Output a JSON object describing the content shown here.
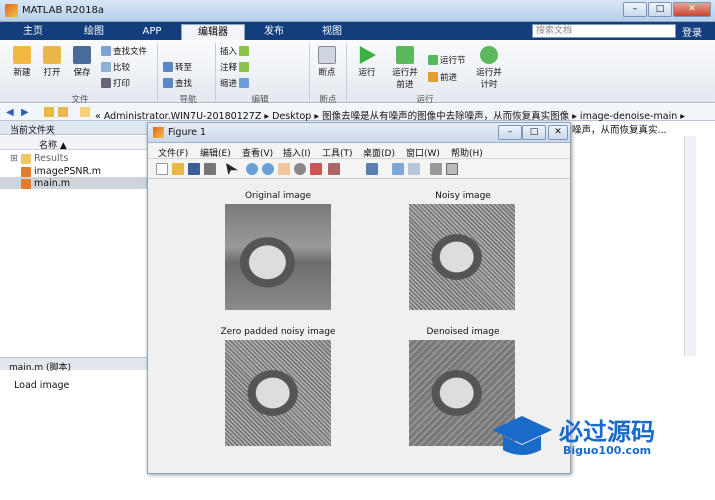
{
  "app": {
    "title": "MATLAB R2018a"
  },
  "tabs": [
    "主页",
    "绘图",
    "APP",
    "编辑器",
    "发布",
    "视图"
  ],
  "search": {
    "placeholder": "搜索文档"
  },
  "login": "登录",
  "ribbon": {
    "new": "新建",
    "open": "打开",
    "save": "保存",
    "find_files": "查找文件",
    "compare": "比较",
    "print": "打印",
    "insert": "插入",
    "comment": "注释",
    "indent": "缩进",
    "goto": "转至",
    "find": "查找",
    "breakpoints": "断点",
    "run": "运行",
    "run_advance": "运行并\n前进",
    "run_section": "运行节",
    "advance": "前进",
    "run_time": "运行并\n计时",
    "groups": [
      "文件",
      "导航",
      "编辑",
      "断点",
      "运行"
    ]
  },
  "path": "« Administrator.WIN7U-20180127Z ▸ Desktop ▸ 图像去噪是从有噪声的图像中去除噪声，从而恢复真实图像 ▸ image-denoise-main ▸",
  "current_folder": "当前文件夹",
  "col_name": "名称 ▲",
  "files": [
    "Results",
    "imagePSNR.m",
    "main.m"
  ],
  "detail": "main.m  (脚本)",
  "right_fragment": "噪声，从而恢复真实...",
  "command": "Load image",
  "figure": {
    "title": "Figure 1",
    "menus": [
      "文件(F)",
      "编辑(E)",
      "查看(V)",
      "插入(I)",
      "工具(T)",
      "桌面(D)",
      "窗口(W)",
      "帮助(H)"
    ],
    "plots": [
      "Original image",
      "Noisy image",
      "Zero padded noisy image",
      "Denoised image"
    ]
  },
  "logo": {
    "cn": "必过源码",
    "en": "Biguo100.com",
    "color": "#1a6bc9"
  }
}
